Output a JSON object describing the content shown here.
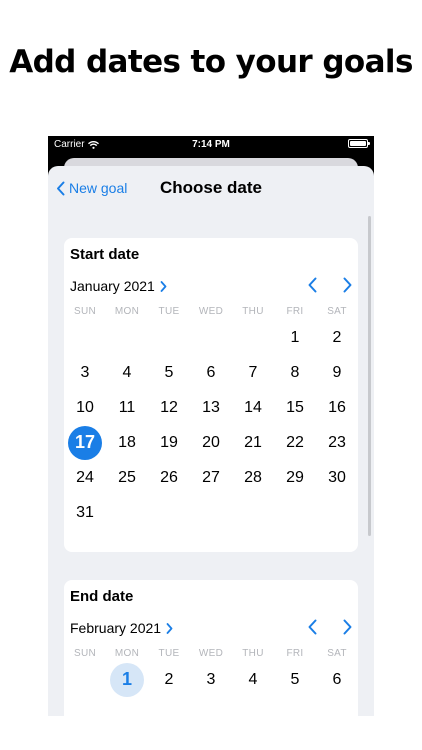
{
  "headline": "Add dates to your goals",
  "status_bar": {
    "carrier": "Carrier",
    "time": "7:14 PM"
  },
  "nav": {
    "back_label": "New goal",
    "title": "Choose date"
  },
  "accent_color": "#1a7ee6",
  "weekdays": [
    "SUN",
    "MON",
    "TUE",
    "WED",
    "THU",
    "FRI",
    "SAT"
  ],
  "start_date": {
    "title": "Start date",
    "month_label": "January 2021",
    "selected_day": "17",
    "weeks": [
      [
        "",
        "",
        "",
        "",
        "",
        "1",
        "2"
      ],
      [
        "3",
        "4",
        "5",
        "6",
        "7",
        "8",
        "9"
      ],
      [
        "10",
        "11",
        "12",
        "13",
        "14",
        "15",
        "16"
      ],
      [
        "17",
        "18",
        "19",
        "20",
        "21",
        "22",
        "23"
      ],
      [
        "24",
        "25",
        "26",
        "27",
        "28",
        "29",
        "30"
      ],
      [
        "31",
        "",
        "",
        "",
        "",
        "",
        ""
      ]
    ]
  },
  "end_date": {
    "title": "End date",
    "month_label": "February 2021",
    "highlighted_day": "1",
    "weeks": [
      [
        "",
        "1",
        "2",
        "3",
        "4",
        "5",
        "6"
      ]
    ]
  }
}
